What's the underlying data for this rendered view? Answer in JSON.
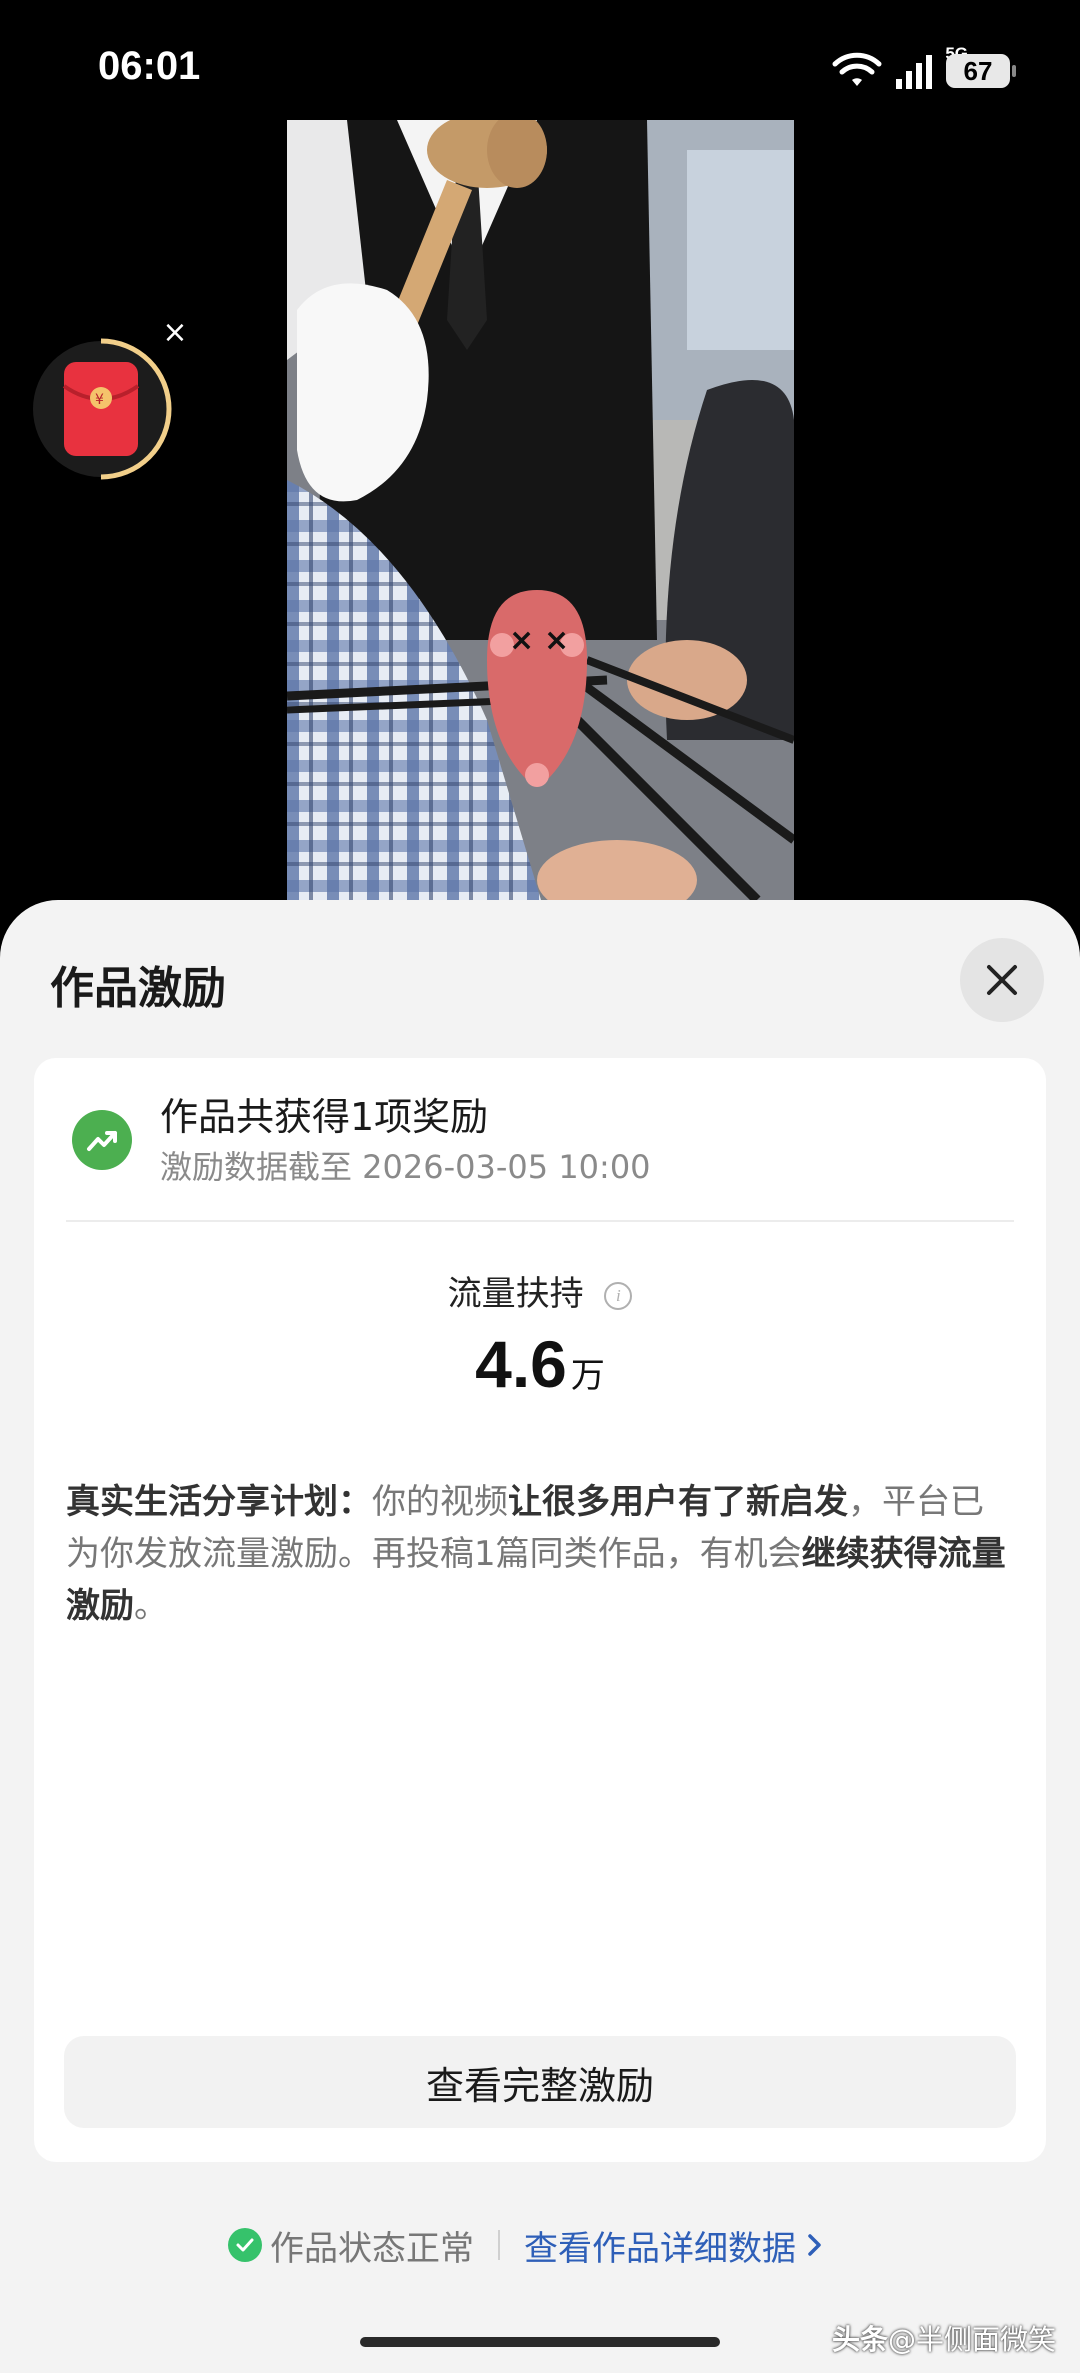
{
  "status_bar": {
    "time": "06:01",
    "network": "5G",
    "battery": "67"
  },
  "video": {
    "widget_icon": "red-packet-icon",
    "widget_close_icon": "close-icon"
  },
  "sheet": {
    "title": "作品激励",
    "close_icon": "close-icon"
  },
  "reward_card": {
    "icon": "trending-up-icon",
    "title": "作品共获得1项奖励",
    "subtitle": "激励数据截至 2026-03-05 10:00",
    "metric": {
      "label": "流量扶持",
      "value": "4.6",
      "unit": "万"
    },
    "description": {
      "prefix_bold": "真实生活分享计划：",
      "part1": "你的视频",
      "part2_bold": "让很多用户有了新启发",
      "part3": "，平台已为你发放流量激励。再投稿1篇同类作品，有机会",
      "part4_bold": "继续获得流量激励",
      "part5": "。"
    },
    "button_label": "查看完整激励"
  },
  "footer": {
    "status_text": "作品状态正常",
    "link_text": "查看作品详细数据"
  },
  "watermark": {
    "brand": "头条",
    "handle": "@半侧面微笑"
  },
  "colors": {
    "accent_green": "#4caf50",
    "link_blue": "#2e5fb8",
    "sheet_bg": "#f3f3f3"
  }
}
